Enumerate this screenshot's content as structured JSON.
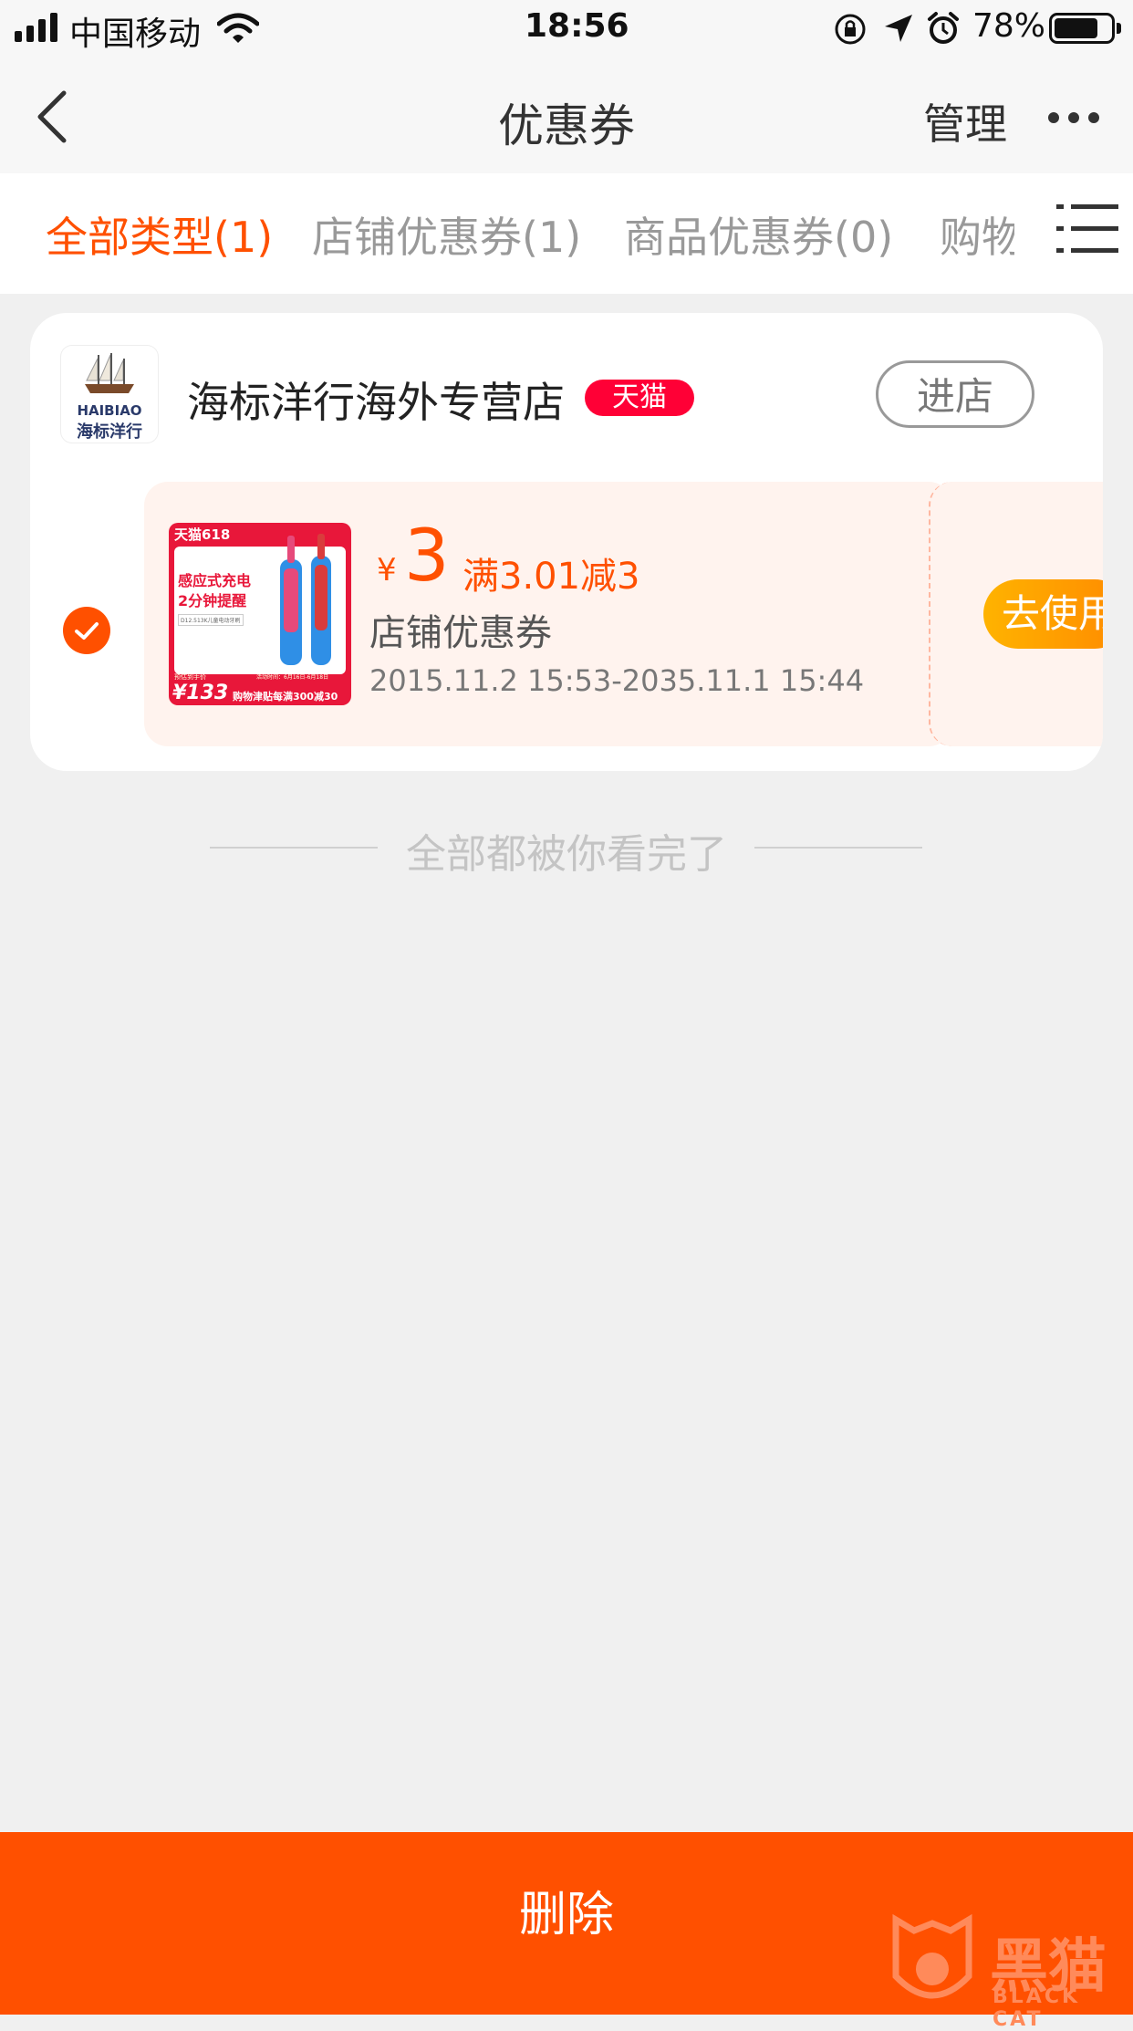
{
  "status": {
    "carrier": "中国移动",
    "time": "18:56",
    "battery": "78%",
    "battery_level": 0.78
  },
  "nav": {
    "title": "优惠券",
    "manage": "管理"
  },
  "tabs": [
    {
      "label": "全部类型(1)",
      "active": true
    },
    {
      "label": "店铺优惠券(1)",
      "active": false
    },
    {
      "label": "商品优惠券(0)",
      "active": false
    },
    {
      "label": "购物",
      "active": false
    }
  ],
  "store": {
    "logo_text_en": "HAIBIAO",
    "logo_text_cn": "海标洋行",
    "name": "海标洋行海外专营店",
    "badge": "天猫",
    "enter": "进店"
  },
  "coupon": {
    "selected": true,
    "currency": "¥",
    "amount": "3",
    "condition": "满3.01减3",
    "type": "店铺优惠券",
    "validity": "2015.11.2 15:53-2035.11.1 15:44",
    "use_button": "去使用",
    "thumb": {
      "badge": "天猫618",
      "line1": "感应式充电",
      "line2": "2分钟提醒",
      "line3": "D12.513K儿童电动牙刷",
      "price_label": "预估到手价",
      "price": "¥133",
      "promo": "购物津贴每满300减30",
      "promo_date": "活动时间：6月16日-6月18日"
    }
  },
  "end_text": "全部都被你看完了",
  "bottom": {
    "delete": "删除",
    "watermark": "黑猫",
    "watermark_en": "BLACK CAT"
  }
}
